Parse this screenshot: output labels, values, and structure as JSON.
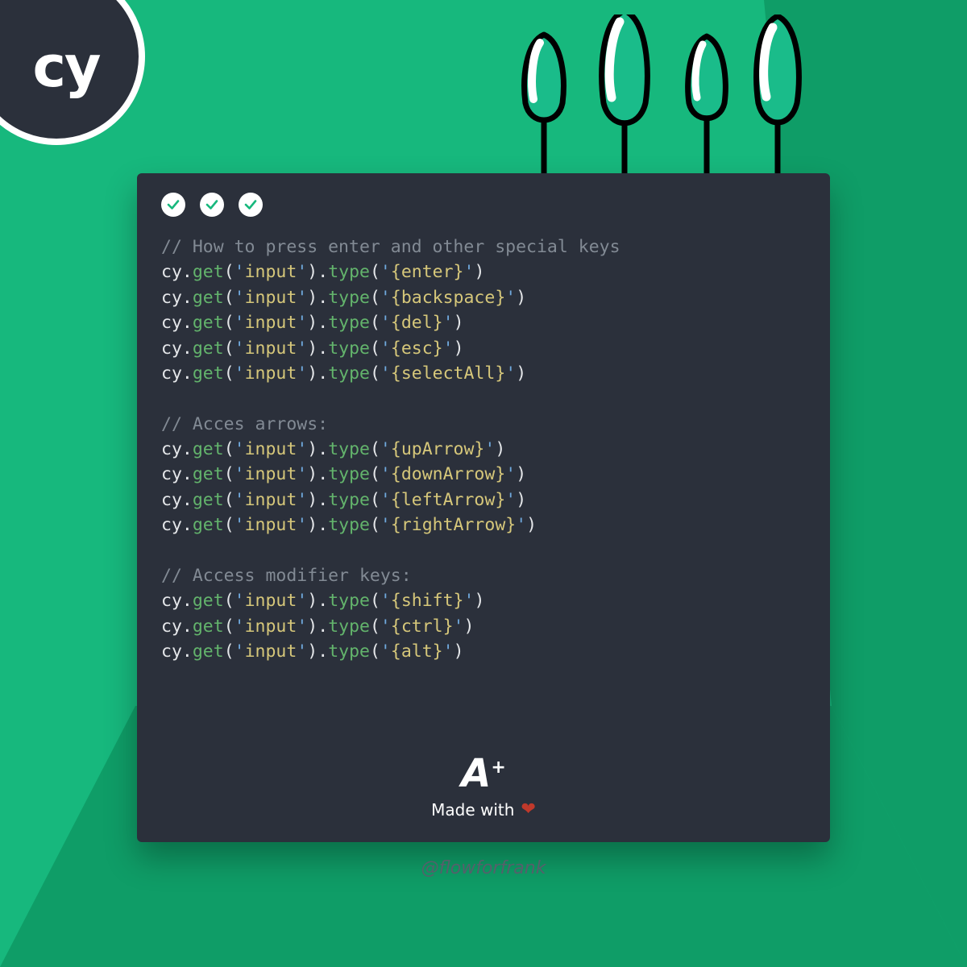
{
  "badge": {
    "text": "cy"
  },
  "checkmarks": {
    "count": 3
  },
  "code": {
    "blocks": [
      {
        "comment": "// How to press enter and other special keys",
        "lines": [
          {
            "selector": "input",
            "key": "enter"
          },
          {
            "selector": "input",
            "key": "backspace"
          },
          {
            "selector": "input",
            "key": "del"
          },
          {
            "selector": "input",
            "key": "esc"
          },
          {
            "selector": "input",
            "key": "selectAll"
          }
        ]
      },
      {
        "comment": "// Acces arrows:",
        "lines": [
          {
            "selector": "input",
            "key": "upArrow"
          },
          {
            "selector": "input",
            "key": "downArrow"
          },
          {
            "selector": "input",
            "key": "leftArrow"
          },
          {
            "selector": "input",
            "key": "rightArrow"
          }
        ]
      },
      {
        "comment": "// Access modifier keys:",
        "lines": [
          {
            "selector": "input",
            "key": "shift"
          },
          {
            "selector": "input",
            "key": "ctrl"
          },
          {
            "selector": "input",
            "key": "alt"
          }
        ]
      }
    ],
    "tokens": {
      "obj": "cy",
      "get": "get",
      "type": "type"
    }
  },
  "footer": {
    "logo_main": "A",
    "logo_plus": "+",
    "made_with": "Made with"
  },
  "handle": "@flowforfrank"
}
